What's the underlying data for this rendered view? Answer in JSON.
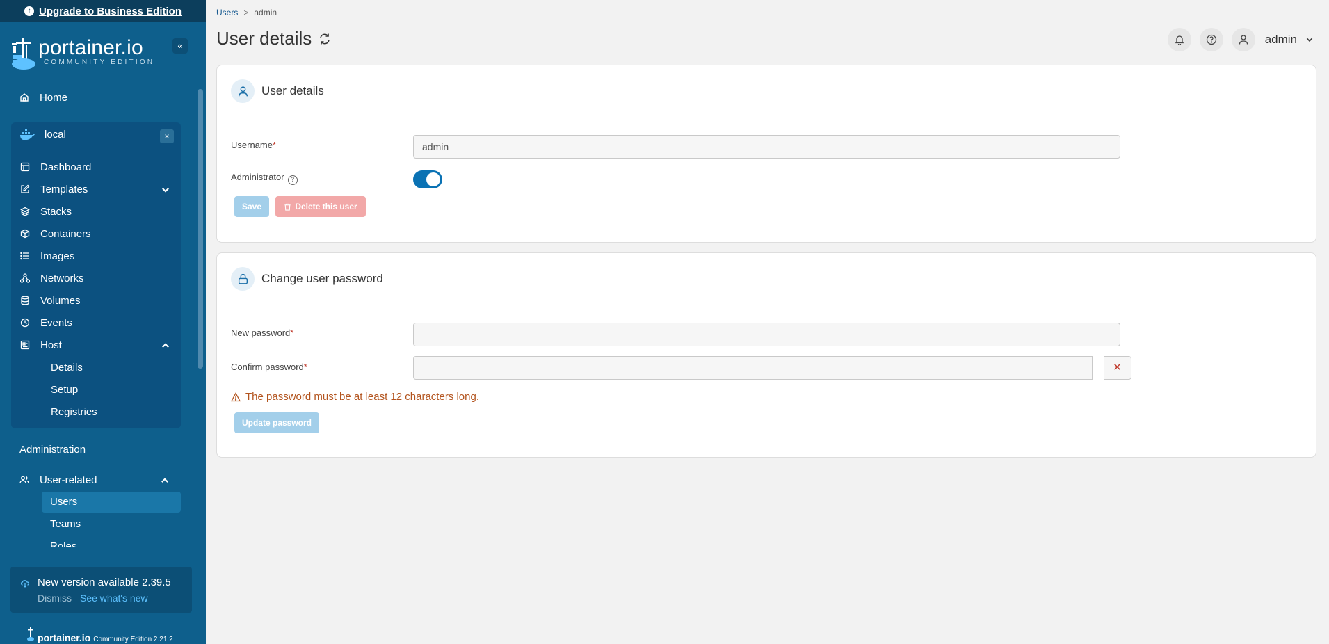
{
  "sidebar": {
    "upgrade_text": "Upgrade to Business Edition",
    "logo_word": "portainer.io",
    "logo_sub": "COMMUNITY EDITION",
    "collapse_glyph": "«",
    "home": "Home",
    "environment": {
      "name": "local",
      "close_glyph": "×"
    },
    "env_items": [
      {
        "label": "Dashboard",
        "icon": "dashboard-icon"
      },
      {
        "label": "Templates",
        "icon": "edit-icon"
      },
      {
        "label": "Stacks",
        "icon": "layers-icon"
      },
      {
        "label": "Containers",
        "icon": "box-icon"
      },
      {
        "label": "Images",
        "icon": "list-icon"
      },
      {
        "label": "Networks",
        "icon": "network-icon"
      },
      {
        "label": "Volumes",
        "icon": "database-icon"
      },
      {
        "label": "Events",
        "icon": "clock-icon"
      },
      {
        "label": "Host",
        "icon": "host-icon"
      }
    ],
    "host_sub_items": [
      "Details",
      "Setup",
      "Registries"
    ],
    "administration_label": "Administration",
    "user_related": "User-related",
    "user_sub_items": [
      "Users",
      "Teams",
      "Roles"
    ],
    "update": {
      "title": "New version available 2.39.5",
      "dismiss": "Dismiss",
      "whats_new": "See what's new"
    },
    "footer_brand": "portainer.io",
    "footer_version": "Community Edition 2.21.2"
  },
  "header": {
    "breadcrumb_link": "Users",
    "breadcrumb_sep": ">",
    "breadcrumb_current": "admin",
    "title": "User details",
    "user": "admin"
  },
  "user_details": {
    "heading": "User details",
    "username_label": "Username",
    "username_value": "admin",
    "admin_label": "Administrator",
    "admin_enabled": true,
    "save_label": "Save",
    "delete_label": "Delete this user"
  },
  "change_password": {
    "heading": "Change user password",
    "new_label": "New password",
    "confirm_label": "Confirm password",
    "required_mark": "*",
    "warning": "The password must be at least 12 characters long.",
    "update_label": "Update password",
    "clear_glyph": "✕"
  },
  "colors": {
    "sidebar_bg": "#0e5f8c",
    "accent": "#0a72b4",
    "warning": "#b3541e"
  }
}
